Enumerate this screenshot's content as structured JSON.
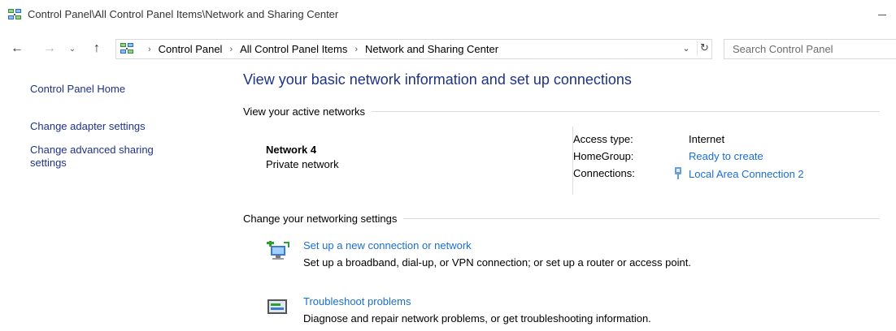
{
  "window": {
    "title": "Control Panel\\All Control Panel Items\\Network and Sharing Center",
    "icon": "network-sharing-icon"
  },
  "navigation": {
    "back_icon": "arrow-left-icon",
    "forward_icon": "arrow-right-icon",
    "recent_icon": "chevron-down-icon",
    "up_icon": "arrow-up-icon"
  },
  "address_bar": {
    "breadcrumbs": [
      "Control Panel",
      "All Control Panel Items",
      "Network and Sharing Center"
    ],
    "separator": "›"
  },
  "search": {
    "placeholder": "Search Control Panel"
  },
  "left_pane": {
    "home": "Control Panel Home",
    "adapter_settings": "Change adapter settings",
    "advanced_sharing": "Change advanced sharing settings"
  },
  "main": {
    "title": "View your basic network information and set up connections",
    "active_networks_header": "View your active networks",
    "network": {
      "name": "Network  4",
      "category": "Private network"
    },
    "properties": {
      "access_type_label": "Access type:",
      "access_type_value": "Internet",
      "homegroup_label": "HomeGroup:",
      "homegroup_value": "Ready to create",
      "connections_label": "Connections:",
      "connections_value": "Local Area Connection 2"
    },
    "change_settings_header": "Change your networking settings",
    "tasks": [
      {
        "title": "Set up a new connection or network",
        "description": "Set up a broadband, dial-up, or VPN connection; or set up a router or access point."
      },
      {
        "title": "Troubleshoot problems",
        "description": "Diagnose and repair network problems, or get troubleshooting information."
      }
    ]
  },
  "colors": {
    "link": "#1a6ed2",
    "nav_link": "#1e3287",
    "title": "#1e3287"
  }
}
